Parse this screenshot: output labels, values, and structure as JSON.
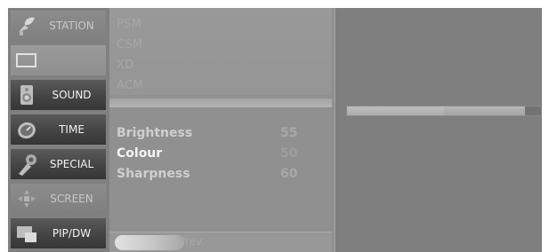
{
  "nav": {
    "items": [
      {
        "label": "STATION",
        "icon": "satellite-icon",
        "state": "normal"
      },
      {
        "label": "",
        "icon": "picture-icon",
        "state": "selected"
      },
      {
        "label": "SOUND",
        "icon": "speaker-icon",
        "state": "dark"
      },
      {
        "label": "TIME",
        "icon": "clock-icon",
        "state": "dark"
      },
      {
        "label": "SPECIAL",
        "icon": "special-icon",
        "state": "dark"
      },
      {
        "label": "SCREEN",
        "icon": "screen-move-icon",
        "state": "normal"
      },
      {
        "label": "PIP/DW",
        "icon": "pip-icon",
        "state": "dark"
      }
    ]
  },
  "menu": {
    "presets": [
      "PSM",
      "CSM",
      "XD",
      "ACM"
    ],
    "settings": [
      {
        "label": "Brightness",
        "value": "55",
        "active": false
      },
      {
        "label": "Colour",
        "value": "50",
        "active": true
      },
      {
        "label": "Sharpness",
        "value": "60",
        "active": false
      }
    ],
    "prev_label": "Prev."
  },
  "slider": {
    "fraction": 0.5
  },
  "colors": {
    "frame": "#8d8d8d",
    "nav_dark": "#444444",
    "menu_panel": "#909090",
    "right_panel": "#7f7f7f",
    "text_bright": "#f4f4f4",
    "text_muted": "#a6a6a6"
  }
}
